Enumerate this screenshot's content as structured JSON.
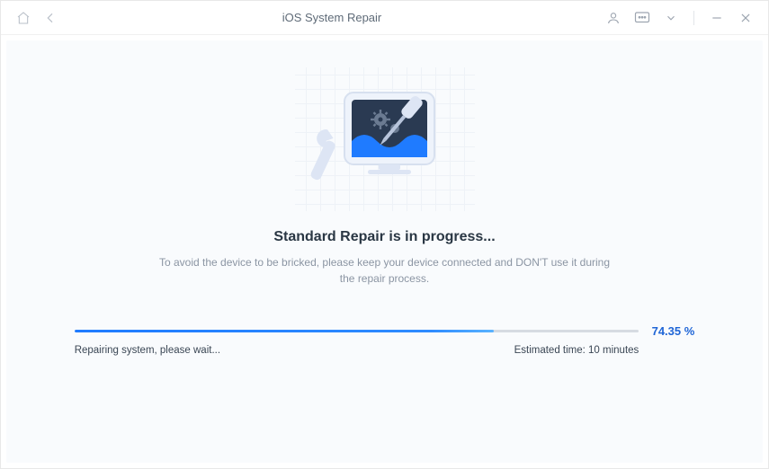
{
  "titlebar": {
    "title": "iOS System Repair"
  },
  "main": {
    "heading": "Standard Repair is in progress...",
    "subtext": "To avoid the device to be bricked, please keep your device connected and DON'T use it during the repair process."
  },
  "progress": {
    "percent_value": 74.35,
    "percent_label": "74.35 %",
    "status_text": "Repairing system, please wait...",
    "estimated_time": "Estimated time: 10 minutes"
  },
  "colors": {
    "accent": "#1f7bff"
  }
}
